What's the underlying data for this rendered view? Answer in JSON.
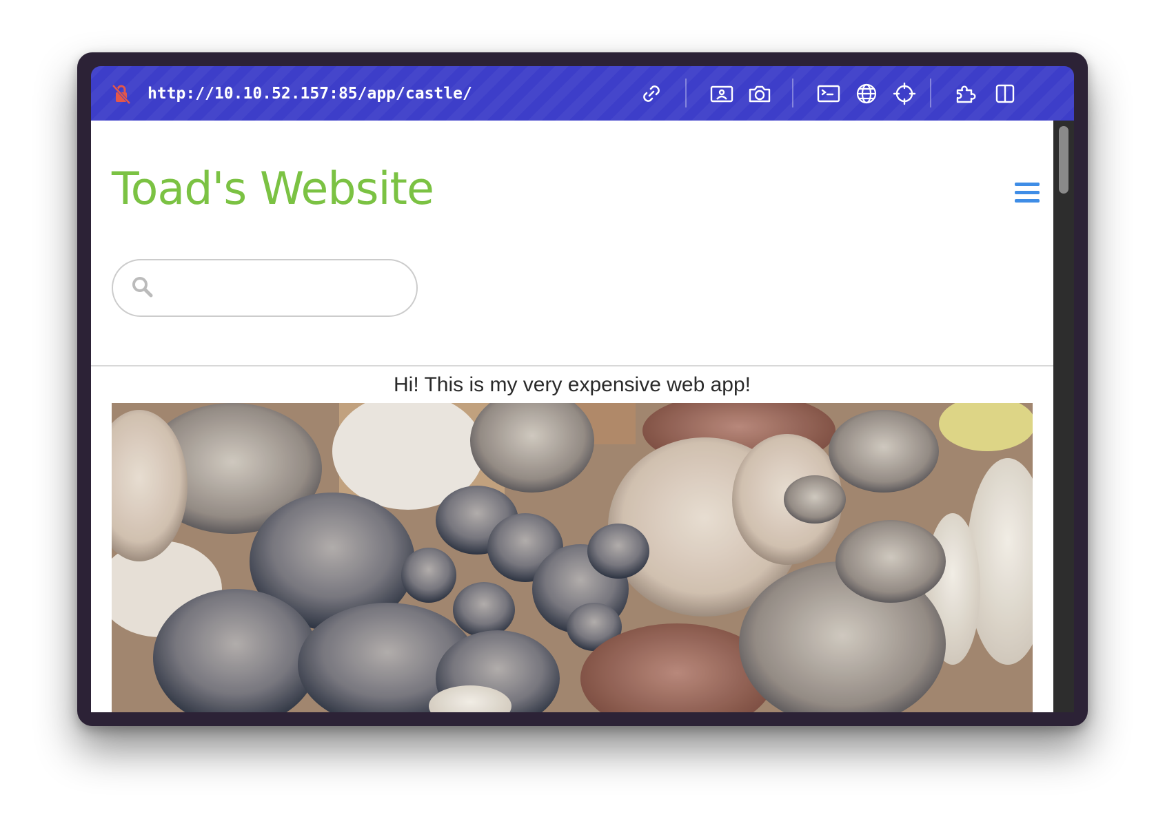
{
  "browser": {
    "url": "http://10.10.52.157:85/app/castle/",
    "security_icon": "insecure-lock-icon",
    "toolbar_icons": [
      "link-icon",
      "image-icon",
      "camera-icon",
      "terminal-icon",
      "globe-icon",
      "crosshair-icon",
      "extension-icon",
      "sidebar-icon"
    ],
    "accent_color": "#3d3ec9"
  },
  "site": {
    "title": "Toad's Website",
    "title_color": "#7bc243",
    "menu_icon": "hamburger-menu-icon",
    "menu_color": "#3f8de6"
  },
  "search": {
    "icon": "search-icon",
    "value": "",
    "placeholder": ""
  },
  "content": {
    "intro": "Hi! This is my very expensive web app!",
    "hero_image": "mushrooms-photo"
  }
}
